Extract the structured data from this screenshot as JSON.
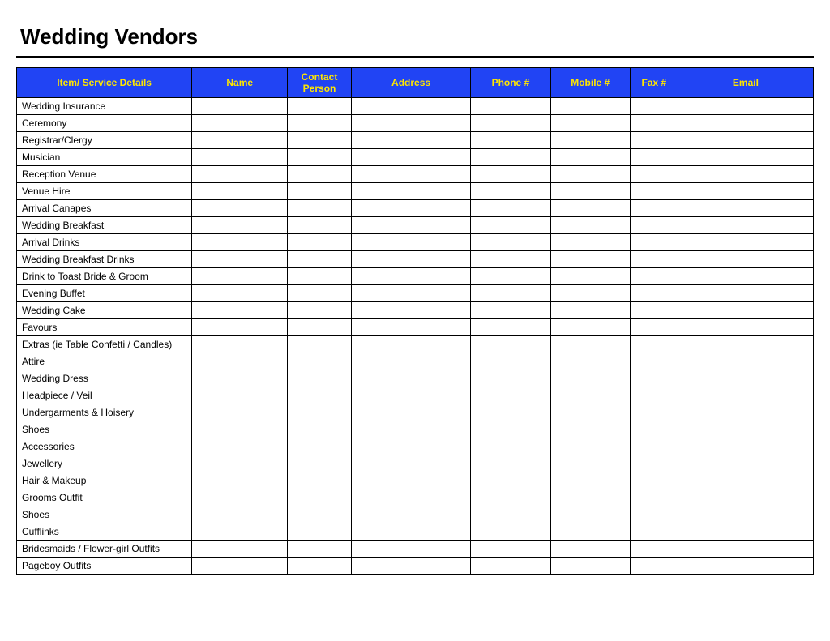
{
  "title": "Wedding Vendors",
  "columns": [
    "Item/ Service Details",
    "Name",
    "Contact Person",
    "Address",
    "Phone #",
    "Mobile #",
    "Fax #",
    "Email"
  ],
  "rows": [
    {
      "item": "Wedding Insurance",
      "name": "",
      "contact": "",
      "address": "",
      "phone": "",
      "mobile": "",
      "fax": "",
      "email": ""
    },
    {
      "item": "Ceremony",
      "name": "",
      "contact": "",
      "address": "",
      "phone": "",
      "mobile": "",
      "fax": "",
      "email": ""
    },
    {
      "item": "Registrar/Clergy",
      "name": "",
      "contact": "",
      "address": "",
      "phone": "",
      "mobile": "",
      "fax": "",
      "email": ""
    },
    {
      "item": "Musician",
      "name": "",
      "contact": "",
      "address": "",
      "phone": "",
      "mobile": "",
      "fax": "",
      "email": ""
    },
    {
      "item": "Reception Venue",
      "name": "",
      "contact": "",
      "address": "",
      "phone": "",
      "mobile": "",
      "fax": "",
      "email": ""
    },
    {
      "item": "Venue Hire",
      "name": "",
      "contact": "",
      "address": "",
      "phone": "",
      "mobile": "",
      "fax": "",
      "email": ""
    },
    {
      "item": "Arrival Canapes",
      "name": "",
      "contact": "",
      "address": "",
      "phone": "",
      "mobile": "",
      "fax": "",
      "email": ""
    },
    {
      "item": "Wedding Breakfast",
      "name": "",
      "contact": "",
      "address": "",
      "phone": "",
      "mobile": "",
      "fax": "",
      "email": ""
    },
    {
      "item": "Arrival Drinks",
      "name": "",
      "contact": "",
      "address": "",
      "phone": "",
      "mobile": "",
      "fax": "",
      "email": ""
    },
    {
      "item": "Wedding Breakfast Drinks",
      "name": "",
      "contact": "",
      "address": "",
      "phone": "",
      "mobile": "",
      "fax": "",
      "email": ""
    },
    {
      "item": "Drink to Toast Bride & Groom",
      "name": "",
      "contact": "",
      "address": "",
      "phone": "",
      "mobile": "",
      "fax": "",
      "email": ""
    },
    {
      "item": "Evening Buffet",
      "name": "",
      "contact": "",
      "address": "",
      "phone": "",
      "mobile": "",
      "fax": "",
      "email": ""
    },
    {
      "item": "Wedding Cake",
      "name": "",
      "contact": "",
      "address": "",
      "phone": "",
      "mobile": "",
      "fax": "",
      "email": ""
    },
    {
      "item": "Favours",
      "name": "",
      "contact": "",
      "address": "",
      "phone": "",
      "mobile": "",
      "fax": "",
      "email": ""
    },
    {
      "item": "Extras (ie Table Confetti / Candles)",
      "name": "",
      "contact": "",
      "address": "",
      "phone": "",
      "mobile": "",
      "fax": "",
      "email": ""
    },
    {
      "item": "Attire",
      "name": "",
      "contact": "",
      "address": "",
      "phone": "",
      "mobile": "",
      "fax": "",
      "email": ""
    },
    {
      "item": "Wedding Dress",
      "name": "",
      "contact": "",
      "address": "",
      "phone": "",
      "mobile": "",
      "fax": "",
      "email": ""
    },
    {
      "item": "Headpiece / Veil",
      "name": "",
      "contact": "",
      "address": "",
      "phone": "",
      "mobile": "",
      "fax": "",
      "email": ""
    },
    {
      "item": "Undergarments & Hoisery",
      "name": "",
      "contact": "",
      "address": "",
      "phone": "",
      "mobile": "",
      "fax": "",
      "email": ""
    },
    {
      "item": "Shoes",
      "name": "",
      "contact": "",
      "address": "",
      "phone": "",
      "mobile": "",
      "fax": "",
      "email": ""
    },
    {
      "item": "Accessories",
      "name": "",
      "contact": "",
      "address": "",
      "phone": "",
      "mobile": "",
      "fax": "",
      "email": ""
    },
    {
      "item": "Jewellery",
      "name": "",
      "contact": "",
      "address": "",
      "phone": "",
      "mobile": "",
      "fax": "",
      "email": ""
    },
    {
      "item": "Hair & Makeup",
      "name": "",
      "contact": "",
      "address": "",
      "phone": "",
      "mobile": "",
      "fax": "",
      "email": ""
    },
    {
      "item": "Grooms Outfit",
      "name": "",
      "contact": "",
      "address": "",
      "phone": "",
      "mobile": "",
      "fax": "",
      "email": ""
    },
    {
      "item": "Shoes",
      "name": "",
      "contact": "",
      "address": "",
      "phone": "",
      "mobile": "",
      "fax": "",
      "email": ""
    },
    {
      "item": "Cufflinks",
      "name": "",
      "contact": "",
      "address": "",
      "phone": "",
      "mobile": "",
      "fax": "",
      "email": ""
    },
    {
      "item": "Bridesmaids / Flower-girl Outfits",
      "name": "",
      "contact": "",
      "address": "",
      "phone": "",
      "mobile": "",
      "fax": "",
      "email": ""
    },
    {
      "item": "Pageboy Outfits",
      "name": "",
      "contact": "",
      "address": "",
      "phone": "",
      "mobile": "",
      "fax": "",
      "email": ""
    }
  ]
}
